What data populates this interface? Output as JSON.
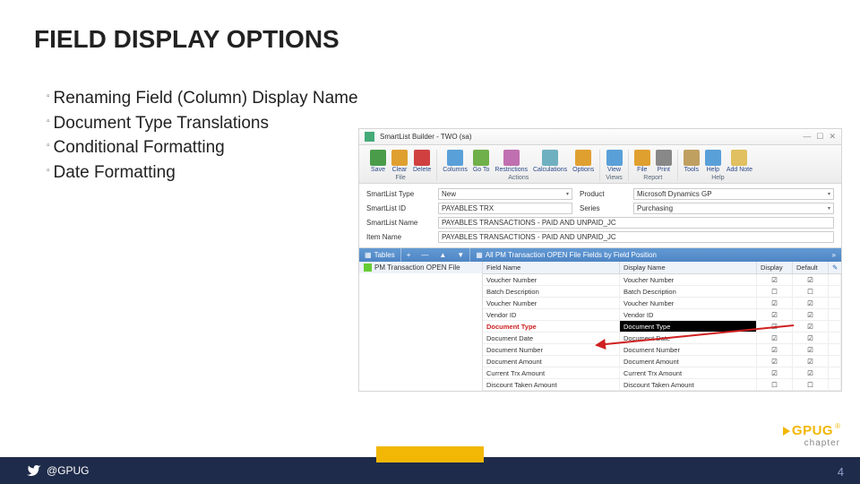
{
  "title": "FIELD DISPLAY OPTIONS",
  "bullets": [
    "Renaming Field (Column) Display Name",
    "Document Type Translations",
    "Conditional Formatting",
    "Date Formatting"
  ],
  "window": {
    "title": "SmartList Builder - TWO (sa)",
    "controls": [
      "—",
      "☐",
      "✕"
    ]
  },
  "ribbon": {
    "groups": {
      "file": {
        "label": "File",
        "items": [
          {
            "l": "Save",
            "c": "#4a9c4a"
          },
          {
            "l": "Clear",
            "c": "#e0a030"
          },
          {
            "l": "Delete",
            "c": "#d04040"
          }
        ]
      },
      "actions": {
        "label": "Actions",
        "items": [
          {
            "l": "Columns",
            "c": "#5aa0d8"
          },
          {
            "l": "Go To",
            "c": "#6fb04a"
          },
          {
            "l": "Restrictions",
            "c": "#c06fb0"
          },
          {
            "l": "Calculations",
            "c": "#6fb0c0"
          },
          {
            "l": "Options",
            "c": "#e0a030"
          }
        ]
      },
      "views": {
        "label": "Views",
        "items": [
          {
            "l": "View",
            "c": "#5aa0d8"
          }
        ]
      },
      "report": {
        "label": "Report",
        "items": [
          {
            "l": "File",
            "c": "#e0a030"
          },
          {
            "l": "Print",
            "c": "#888"
          }
        ]
      },
      "help": {
        "label": "Help",
        "items": [
          {
            "l": "Tools",
            "c": "#c0a060"
          },
          {
            "l": "Help",
            "c": "#5aa0d8"
          },
          {
            "l": "Add Note",
            "c": "#e0c060"
          }
        ]
      }
    }
  },
  "form": {
    "f1": {
      "label": "SmartList Type",
      "value": "New"
    },
    "f2": {
      "label": "Product",
      "value": "Microsoft Dynamics GP"
    },
    "f3": {
      "label": "SmartList ID",
      "value": "PAYABLES TRX"
    },
    "f4": {
      "label": "Series",
      "value": "Purchasing"
    },
    "f5": {
      "label": "SmartList Name",
      "value": "PAYABLES TRANSACTIONS - PAID AND UNPAID_JC"
    },
    "f6": {
      "label": "Item Name",
      "value": "PAYABLES TRANSACTIONS - PAID AND UNPAID_JC"
    }
  },
  "tabs": {
    "left": "Tables",
    "right": "All PM Transaction OPEN File Fields by Field Position",
    "plus": "+",
    "minus": "—",
    "up": "▲",
    "down": "▼",
    "chev": "»"
  },
  "tablesList": {
    "item": "PM Transaction OPEN File"
  },
  "grid": {
    "headers": [
      "Field Name",
      "Display Name",
      "Display",
      "Default",
      "✎"
    ],
    "chk": "☑",
    "un": "☐",
    "rows": [
      {
        "f": "Voucher Number",
        "d": "Voucher Number",
        "a": "☑",
        "b": "☑"
      },
      {
        "f": "Batch Description",
        "d": "Batch Description",
        "a": "☐",
        "b": "☐"
      },
      {
        "f": "Voucher Number",
        "d": "Voucher Number",
        "a": "☑",
        "b": "☑"
      },
      {
        "f": "Vendor ID",
        "d": "Vendor ID",
        "a": "☑",
        "b": "☑"
      },
      {
        "f": "Document Type",
        "d": "Document Type",
        "a": "☑",
        "b": "☑",
        "hl": true
      },
      {
        "f": "Document Date",
        "d": "Document Date",
        "a": "☑",
        "b": "☑"
      },
      {
        "f": "Document Number",
        "d": "Document Number",
        "a": "☑",
        "b": "☑"
      },
      {
        "f": "Document Amount",
        "d": "Document Amount",
        "a": "☑",
        "b": "☑"
      },
      {
        "f": "Current Trx Amount",
        "d": "Current Trx Amount",
        "a": "☑",
        "b": "☑"
      },
      {
        "f": "Discount Taken Amount",
        "d": "Discount Taken Amount",
        "a": "☐",
        "b": "☐"
      }
    ]
  },
  "footer": {
    "handle": "@GPUG",
    "page": "4"
  },
  "logo": {
    "text": "GPUG",
    "sub": "chapter"
  }
}
